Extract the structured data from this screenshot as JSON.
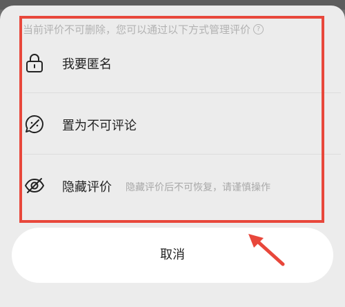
{
  "sheet": {
    "hint_text": "当前评价不可删除，您可以通过以下方式管理评价",
    "hint_icon": "question-circle-icon"
  },
  "options": [
    {
      "icon": "lock-icon",
      "label": "我要匿名",
      "sub": ""
    },
    {
      "icon": "comment-off-icon",
      "label": "置为不可评论",
      "sub": ""
    },
    {
      "icon": "eye-off-icon",
      "label": "隐藏评价",
      "sub": "隐藏评价后不可恢复，请谨慎操作"
    }
  ],
  "cancel_label": "取消",
  "colors": {
    "highlight_border": "#e8473b",
    "sheet_bg": "#ececec",
    "button_bg": "#ffffff"
  }
}
